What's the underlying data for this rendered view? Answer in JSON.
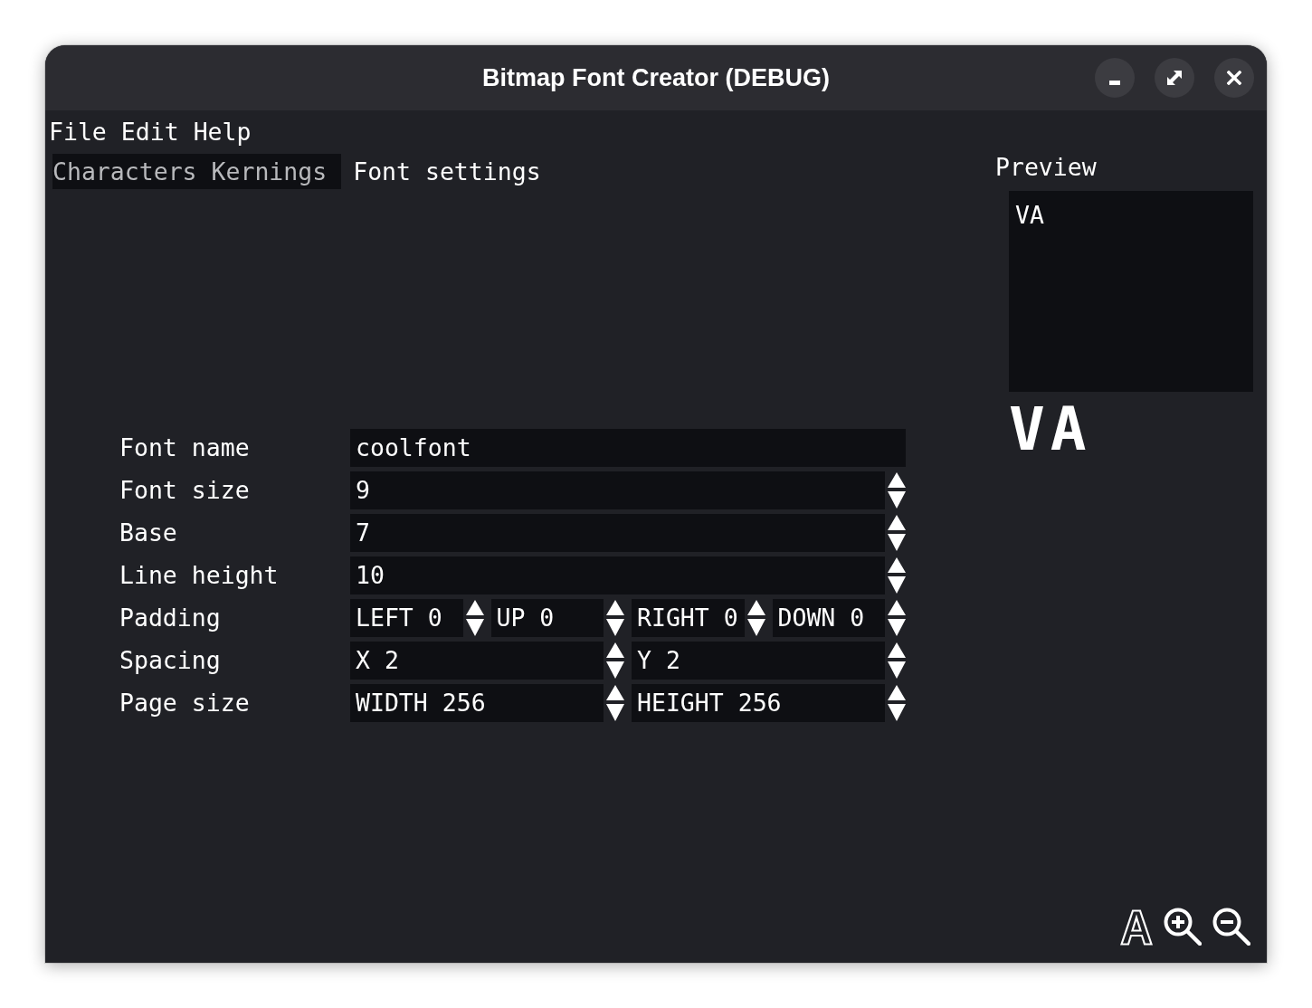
{
  "window": {
    "title": "Bitmap Font Creator (DEBUG)"
  },
  "menu_bar": [
    "File",
    "Edit",
    "Help"
  ],
  "tabs": [
    {
      "label": "Characters",
      "selected": false
    },
    {
      "label": "Kernings",
      "selected": false
    },
    {
      "label": "Font settings",
      "selected": true
    }
  ],
  "font_settings": [
    {
      "label": "Font name",
      "kind": "text",
      "fields": [
        "coolfont"
      ]
    },
    {
      "label": "Font size",
      "kind": "number",
      "fields": [
        "9"
      ]
    },
    {
      "label": "Base",
      "kind": "number",
      "fields": [
        "7"
      ]
    },
    {
      "label": "Line height",
      "kind": "number",
      "fields": [
        "10"
      ]
    },
    {
      "label": "Padding",
      "kind": "number",
      "fields": [
        "LEFT 0",
        "UP 0",
        "RIGHT 0",
        "DOWN 0"
      ]
    },
    {
      "label": "Spacing",
      "kind": "number",
      "fields": [
        "X 2",
        "Y 2"
      ]
    },
    {
      "label": "Page size",
      "kind": "number",
      "fields": [
        "WIDTH 256",
        "HEIGHT 256"
      ]
    }
  ],
  "preview": {
    "label": "Preview",
    "input_text": "VA",
    "rendered_text": "VA"
  }
}
